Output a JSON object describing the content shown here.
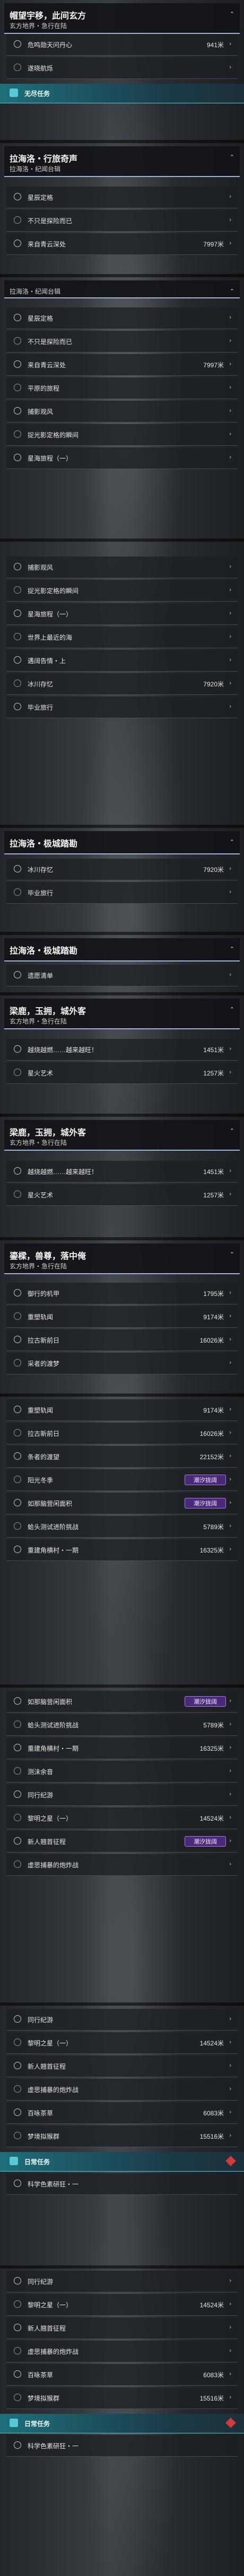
{
  "s1": {
    "title": "帽望宇移，此间玄方",
    "sub": "玄方地界・急行在陆",
    "rows": [
      {
        "l": "危鸣勋天问丹心",
        "v": "941米"
      },
      {
        "l": "遂晓航烁",
        "v": ""
      }
    ],
    "tag": "无尽任务"
  },
  "s2": {
    "title": "拉海洛・行旅奇声",
    "sub": "拉海洛・纪闻台辑",
    "rows": [
      {
        "l": "星辰定格",
        "v": ""
      },
      {
        "l": "不只是探险而已",
        "v": ""
      },
      {
        "l": "来自青云深处",
        "v": "7997米"
      }
    ]
  },
  "s3": {
    "sub": "拉海洛・纪闻台辑",
    "rows": [
      {
        "l": "星辰定格",
        "v": ""
      },
      {
        "l": "不只是探险而已",
        "v": ""
      },
      {
        "l": "来自青云深处",
        "v": "7997米"
      },
      {
        "l": "平原的旅程",
        "v": ""
      },
      {
        "l": "捕影观风",
        "v": ""
      },
      {
        "l": "捉光影定格的瞬间",
        "v": ""
      },
      {
        "l": "星海旅程（一）",
        "v": ""
      }
    ]
  },
  "s4": {
    "rows": [
      {
        "l": "捕影观风",
        "v": ""
      },
      {
        "l": "捉光影定格的瞬间",
        "v": ""
      },
      {
        "l": "星海旅程（一）",
        "v": ""
      },
      {
        "l": "世界上最近的海",
        "v": ""
      },
      {
        "l": "遇阔告情・上",
        "v": ""
      },
      {
        "l": "冰川存忆",
        "v": "7920米"
      },
      {
        "l": "毕业旅行",
        "v": ""
      }
    ]
  },
  "s5": {
    "title": "拉海洛・极城踏勘",
    "rows": [
      {
        "l": "冰川存忆",
        "v": "7920米"
      },
      {
        "l": "毕业旅行",
        "v": ""
      }
    ]
  },
  "s6": {
    "title": "拉海洛・极城踏勘",
    "rows": [
      {
        "l": "遗愿清单",
        "v": ""
      }
    ]
  },
  "s7": {
    "title": "梁鹿，玉拥，城外客",
    "sub": "玄方地界・急行在陆",
    "rows": [
      {
        "l": "越烧越燃……越来越旺！",
        "v": "1451米"
      },
      {
        "l": "星火艺术",
        "v": "1257米"
      }
    ]
  },
  "s8": {
    "title": "梁鹿，玉拥，城外客",
    "sub": "玄方地界・急行在陆",
    "rows": [
      {
        "l": "越烧越燃……越来越旺！",
        "v": "1451米"
      },
      {
        "l": "星火艺术",
        "v": "1257米"
      }
    ]
  },
  "s9": {
    "title": "鎏樑，兽尊，落中俺",
    "sub": "玄方地界・急行在陆",
    "rows": [
      {
        "l": "御行的机甲",
        "v": "1795米"
      },
      {
        "l": "重塑轨闻",
        "v": "9174米"
      },
      {
        "l": "拉古新前日",
        "v": "16026米"
      },
      {
        "l": "采者的渡梦",
        "v": ""
      }
    ]
  },
  "s10": {
    "rows": [
      {
        "l": "重塑轨闻",
        "v": "9174米"
      },
      {
        "l": "拉古新前日",
        "v": "16026米"
      },
      {
        "l": "条者的渡望",
        "v": "22152米"
      },
      {
        "l": "阳光冬季",
        "v": "",
        "badge": "潮汐拢阔"
      },
      {
        "l": "如那脑营闲面积",
        "v": "",
        "badge": "潮汐拢阔"
      },
      {
        "l": "蛤头测试进阶挑战",
        "v": "5789米"
      },
      {
        "l": "重建角横村・一期",
        "v": "16325米"
      }
    ]
  },
  "s11": {
    "rows": [
      {
        "l": "如那脑营闲面积",
        "v": "",
        "badge": "潮汐拢阔"
      },
      {
        "l": "蛤头测试进阶挑战",
        "v": "5789米"
      },
      {
        "l": "重建角横村・一期",
        "v": "16325米"
      },
      {
        "l": "测沫余音",
        "v": ""
      },
      {
        "l": "同行纪游",
        "v": ""
      },
      {
        "l": "黎明之星（一）",
        "v": "14524米"
      },
      {
        "l": "新人翘首征程",
        "v": "",
        "badge": "潮汐拢阔"
      },
      {
        "l": "虚思捕暴的炮炸战",
        "v": ""
      }
    ]
  },
  "s12": {
    "rows": [
      {
        "l": "同行纪游",
        "v": ""
      },
      {
        "l": "黎明之星（一）",
        "v": "14524米"
      },
      {
        "l": "新人翘首征程",
        "v": ""
      },
      {
        "l": "虚思捕暴的炮炸战",
        "v": ""
      },
      {
        "l": "百咏茶草",
        "v": "6083米"
      },
      {
        "l": "梦境拟猴群",
        "v": "15516米"
      }
    ],
    "tag": "日常任务",
    "extra": "科学色素研狂・一"
  },
  "s13": {
    "rows": [
      {
        "l": "同行纪游",
        "v": ""
      },
      {
        "l": "黎明之星（一）",
        "v": "14524米"
      },
      {
        "l": "新人翘首征程",
        "v": ""
      },
      {
        "l": "虚思捕暴的炮炸战",
        "v": ""
      },
      {
        "l": "百咏茶草",
        "v": "6083米"
      },
      {
        "l": "梦境拟猴群",
        "v": "15516米"
      }
    ],
    "tag": "日常任务",
    "extra": "科学色素研狂・一"
  }
}
